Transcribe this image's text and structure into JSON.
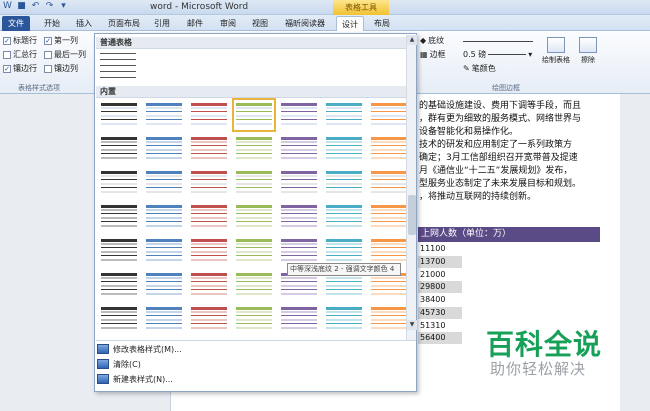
{
  "window": {
    "title": "word - Microsoft Word",
    "context_tools": "表格工具"
  },
  "qat": [
    "W",
    "■",
    "↶",
    "↷",
    "▾"
  ],
  "tabs": [
    "文件",
    "开始",
    "插入",
    "页面布局",
    "引用",
    "邮件",
    "审阅",
    "视图",
    "福昕阅读器",
    "设计",
    "布局"
  ],
  "style_options": {
    "items": [
      {
        "label": "标题行",
        "checked": true
      },
      {
        "label": "第一列",
        "checked": true
      },
      {
        "label": "汇总行",
        "checked": false
      },
      {
        "label": "最后一列",
        "checked": false
      },
      {
        "label": "镶边行",
        "checked": true
      },
      {
        "label": "镶边列",
        "checked": false
      }
    ],
    "group_label": "表格样式选项"
  },
  "ribbon_right": {
    "shading": "底纹",
    "borders": "边框",
    "pen_weight": "0.5 磅",
    "pen_color": "笔颜色",
    "draw_table": "绘制表格",
    "eraser": "擦除",
    "group_label": "绘图边框"
  },
  "gallery": {
    "plain_header": "普通表格",
    "builtin_header": "内置",
    "tooltip": "中等深浅底纹 2 - 强调文字颜色 4",
    "menu": [
      "修改表格样式(M)...",
      "清除(C)",
      "新建表样式(N)..."
    ]
  },
  "document": {
    "lines": [
      "的基础设施建设、费用下调等手段，而且",
      "，群有更为细致的服务模式、网络世界与",
      "设备智能化和易操作化。",
      "技术的研发和应用制定了一系列政策方",
      "确定；3月工信部组织召开宽带普及提速",
      "月《通信业“十二五”发展规划》发布，",
      "型服务业态制定了未来发展目标和规划。",
      "，将推动互联网的持续创新。"
    ],
    "table_header": "上网人数（单位：万）",
    "table_values": [
      "11100",
      "13700",
      "21000",
      "29800",
      "38400",
      "45730",
      "51310",
      "56400"
    ]
  },
  "watermark": {
    "main": "百科全说",
    "sub": "助你轻松解决"
  },
  "colors": {
    "accent_blue": "#4f81bd",
    "accent_purple": "#8064a2",
    "accent_red": "#c0504d",
    "accent_green": "#9bbb59",
    "accent_aqua": "#4bacc6",
    "accent_orange": "#f79646",
    "table_header": "#5a4a86",
    "watermark_green": "#17a058"
  }
}
